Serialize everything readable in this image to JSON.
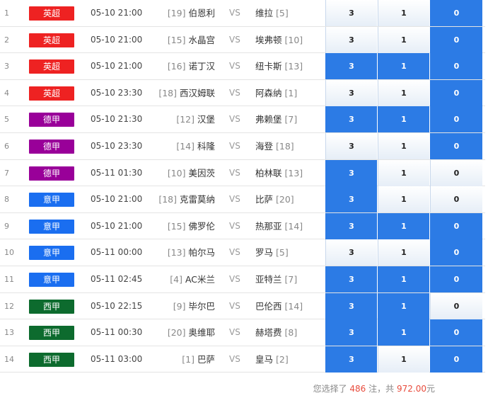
{
  "colors": {
    "selected": "#2c7be5",
    "unselected": "#eef3f9",
    "league_epl": "#ee2222",
    "league_bundesliga": "#990099",
    "league_seriea": "#1a6ef0",
    "league_laliga": "#0d6b2e",
    "highlight": "#e84c3d"
  },
  "matches": [
    {
      "idx": "1",
      "league": "英超",
      "league_color": "#ee2222",
      "time": "05-10 21:00",
      "home_rank": "[19]",
      "home": "伯恩利",
      "vs": "VS",
      "away": "维拉",
      "away_rank": "[5]",
      "odds": [
        "3",
        "1",
        "0"
      ],
      "selected": [
        false,
        false,
        true
      ]
    },
    {
      "idx": "2",
      "league": "英超",
      "league_color": "#ee2222",
      "time": "05-10 21:00",
      "home_rank": "[15]",
      "home": "水晶宫",
      "vs": "VS",
      "away": "埃弗顿",
      "away_rank": "[10]",
      "odds": [
        "3",
        "1",
        "0"
      ],
      "selected": [
        false,
        false,
        true
      ]
    },
    {
      "idx": "3",
      "league": "英超",
      "league_color": "#ee2222",
      "time": "05-10 21:00",
      "home_rank": "[16]",
      "home": "诺丁汉",
      "vs": "VS",
      "away": "纽卡斯",
      "away_rank": "[13]",
      "odds": [
        "3",
        "1",
        "0"
      ],
      "selected": [
        true,
        true,
        true
      ]
    },
    {
      "idx": "4",
      "league": "英超",
      "league_color": "#ee2222",
      "time": "05-10 23:30",
      "home_rank": "[18]",
      "home": "西汉姆联",
      "vs": "VS",
      "away": "阿森纳",
      "away_rank": "[1]",
      "odds": [
        "3",
        "1",
        "0"
      ],
      "selected": [
        false,
        false,
        true
      ]
    },
    {
      "idx": "5",
      "league": "德甲",
      "league_color": "#990099",
      "time": "05-10 21:30",
      "home_rank": "[12]",
      "home": "汉堡",
      "vs": "VS",
      "away": "弗赖堡",
      "away_rank": "[7]",
      "odds": [
        "3",
        "1",
        "0"
      ],
      "selected": [
        true,
        true,
        true
      ]
    },
    {
      "idx": "6",
      "league": "德甲",
      "league_color": "#990099",
      "time": "05-10 23:30",
      "home_rank": "[14]",
      "home": "科隆",
      "vs": "VS",
      "away": "海登",
      "away_rank": "[18]",
      "odds": [
        "3",
        "1",
        "0"
      ],
      "selected": [
        false,
        false,
        true
      ]
    },
    {
      "idx": "7",
      "league": "德甲",
      "league_color": "#990099",
      "time": "05-11 01:30",
      "home_rank": "[10]",
      "home": "美因茨",
      "vs": "VS",
      "away": "柏林联",
      "away_rank": "[13]",
      "odds": [
        "3",
        "1",
        "0"
      ],
      "selected": [
        true,
        false,
        false
      ]
    },
    {
      "idx": "8",
      "league": "意甲",
      "league_color": "#1a6ef0",
      "time": "05-10 21:00",
      "home_rank": "[18]",
      "home": "克雷莫纳",
      "vs": "VS",
      "away": "比萨",
      "away_rank": "[20]",
      "odds": [
        "3",
        "1",
        "0"
      ],
      "selected": [
        true,
        false,
        false
      ]
    },
    {
      "idx": "9",
      "league": "意甲",
      "league_color": "#1a6ef0",
      "time": "05-10 21:00",
      "home_rank": "[15]",
      "home": "佛罗伦",
      "vs": "VS",
      "away": "热那亚",
      "away_rank": "[14]",
      "odds": [
        "3",
        "1",
        "0"
      ],
      "selected": [
        true,
        true,
        true
      ]
    },
    {
      "idx": "10",
      "league": "意甲",
      "league_color": "#1a6ef0",
      "time": "05-11 00:00",
      "home_rank": "[13]",
      "home": "帕尔马",
      "vs": "VS",
      "away": "罗马",
      "away_rank": "[5]",
      "odds": [
        "3",
        "1",
        "0"
      ],
      "selected": [
        false,
        false,
        true
      ]
    },
    {
      "idx": "11",
      "league": "意甲",
      "league_color": "#1a6ef0",
      "time": "05-11 02:45",
      "home_rank": "[4]",
      "home": "AC米兰",
      "vs": "VS",
      "away": "亚特兰",
      "away_rank": "[7]",
      "odds": [
        "3",
        "1",
        "0"
      ],
      "selected": [
        true,
        true,
        true
      ]
    },
    {
      "idx": "12",
      "league": "西甲",
      "league_color": "#0d6b2e",
      "time": "05-10 22:15",
      "home_rank": "[9]",
      "home": "毕尔巴",
      "vs": "VS",
      "away": "巴伦西",
      "away_rank": "[14]",
      "odds": [
        "3",
        "1",
        "0"
      ],
      "selected": [
        true,
        true,
        false
      ]
    },
    {
      "idx": "13",
      "league": "西甲",
      "league_color": "#0d6b2e",
      "time": "05-11 00:30",
      "home_rank": "[20]",
      "home": "奥维耶",
      "vs": "VS",
      "away": "赫塔费",
      "away_rank": "[8]",
      "odds": [
        "3",
        "1",
        "0"
      ],
      "selected": [
        true,
        true,
        true
      ]
    },
    {
      "idx": "14",
      "league": "西甲",
      "league_color": "#0d6b2e",
      "time": "05-11 03:00",
      "home_rank": "[1]",
      "home": "巴萨",
      "vs": "VS",
      "away": "皇马",
      "away_rank": "[2]",
      "odds": [
        "3",
        "1",
        "0"
      ],
      "selected": [
        true,
        false,
        true
      ]
    }
  ],
  "footer": {
    "prefix": "您选择了",
    "count": "486",
    "mid": "注，共",
    "amount": "972.00",
    "suffix": "元"
  }
}
